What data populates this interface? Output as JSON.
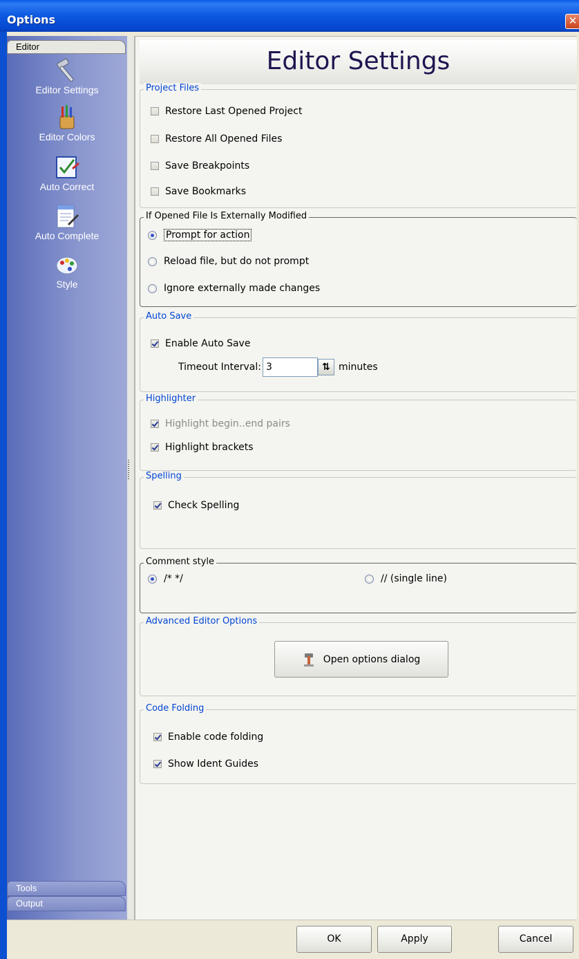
{
  "window": {
    "title": "Options",
    "close_icon": "close-icon"
  },
  "sidebar": {
    "active_tab": "Editor",
    "items": [
      {
        "label": "Editor Settings",
        "icon": "hammer-icon"
      },
      {
        "label": "Editor Colors",
        "icon": "paintbrushes-icon"
      },
      {
        "label": "Auto Correct",
        "icon": "checklist-icon"
      },
      {
        "label": "Auto Complete",
        "icon": "document-pencil-icon"
      },
      {
        "label": "Style",
        "icon": "palette-icon"
      }
    ],
    "bottom_tabs": [
      "Tools",
      "Output"
    ]
  },
  "page": {
    "title": "Editor Settings"
  },
  "project_files": {
    "title": "Project Files",
    "options": [
      {
        "label": "Restore Last Opened Project",
        "checked": false
      },
      {
        "label": "Restore All Opened Files",
        "checked": false
      },
      {
        "label": "Save Breakpoints",
        "checked": false
      },
      {
        "label": "Save Bookmarks",
        "checked": false
      }
    ]
  },
  "external_mod": {
    "title": "If Opened File Is Externally Modified",
    "options": [
      {
        "label": "Prompt for action",
        "selected": true
      },
      {
        "label": "Reload file, but do not prompt",
        "selected": false
      },
      {
        "label": "Ignore externally made changes",
        "selected": false
      }
    ]
  },
  "auto_save": {
    "title": "Auto Save",
    "enable_label": "Enable Auto Save",
    "enabled": true,
    "timeout_label": "Timeout Interval:",
    "timeout_value": "3",
    "unit_label": "minutes"
  },
  "highlighter": {
    "title": "Highlighter",
    "options": [
      {
        "label": "Highlight begin..end pairs",
        "checked": true,
        "disabled": true
      },
      {
        "label": "Highlight brackets",
        "checked": true,
        "disabled": false
      }
    ]
  },
  "spelling": {
    "title": "Spelling",
    "check_label": "Check Spelling",
    "checked": true
  },
  "comment_style": {
    "title": "Comment style",
    "options": [
      {
        "label": "/* */",
        "selected": true
      },
      {
        "label": "// (single line)",
        "selected": false
      }
    ]
  },
  "advanced": {
    "title": "Advanced Editor Options",
    "button_label": "Open options dialog",
    "button_icon": "wrench-icon"
  },
  "code_folding": {
    "title": "Code Folding",
    "options": [
      {
        "label": "Enable code folding",
        "checked": true
      },
      {
        "label": "Show Ident Guides",
        "checked": true
      }
    ]
  },
  "buttons": {
    "ok": "OK",
    "apply": "Apply",
    "cancel": "Cancel"
  },
  "colors": {
    "title_bar": "#0A5AE6",
    "sidebar": "#8A97CF",
    "group_title": "#0046D5",
    "page_title": "#1E1650"
  }
}
